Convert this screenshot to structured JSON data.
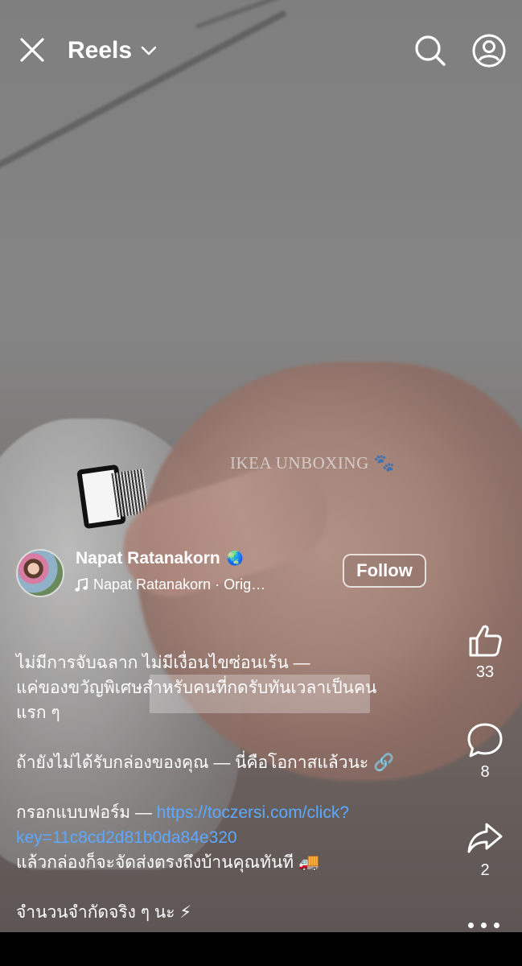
{
  "header": {
    "title": "Reels",
    "close_icon": "close-icon",
    "dropdown_icon": "chevron-down-icon",
    "search_icon": "search-icon",
    "profile_icon": "profile-icon"
  },
  "video": {
    "overlay_text": "IKEA UNBOXING",
    "overlay_emoji": "🐾"
  },
  "author": {
    "name": "Napat Ratanakorn",
    "name_emoji": "🌏",
    "audio": "Napat Ratanakorn · Orig…",
    "follow_label": "Follow"
  },
  "caption": {
    "line1": "ไม่มีการจับฉลาก ไม่มีเงื่อนไขซ่อนเร้น —",
    "line2": "แค่ของขวัญพิเศษสำหรับคนที่กดรับทันเวลาเป็นคน",
    "line3": "แรก ๆ",
    "line4": "ถ้ายังไม่ได้รับกล่องของคุณ — นี่คือโอกาสแล้วนะ",
    "line4_emoji": "🔗",
    "line5_prefix": "กรอกแบบฟอร์ม — ",
    "link_part1": "https://toczersi.com/click?",
    "link_part2": "key=11c8cd2d81b0da84e320",
    "line6": "แล้วกล่องก็จะจัดส่งตรงถึงบ้านคุณทันที",
    "line6_emoji": "🚚",
    "line7": "จำนวนจำกัดจริง ๆ นะ",
    "line7_emoji": "⚡"
  },
  "actions": {
    "like_count": "33",
    "comment_count": "8",
    "share_count": "2",
    "like_icon": "thumbs-up-icon",
    "comment_icon": "comment-icon",
    "share_icon": "share-icon",
    "more_icon": "more-icon"
  }
}
